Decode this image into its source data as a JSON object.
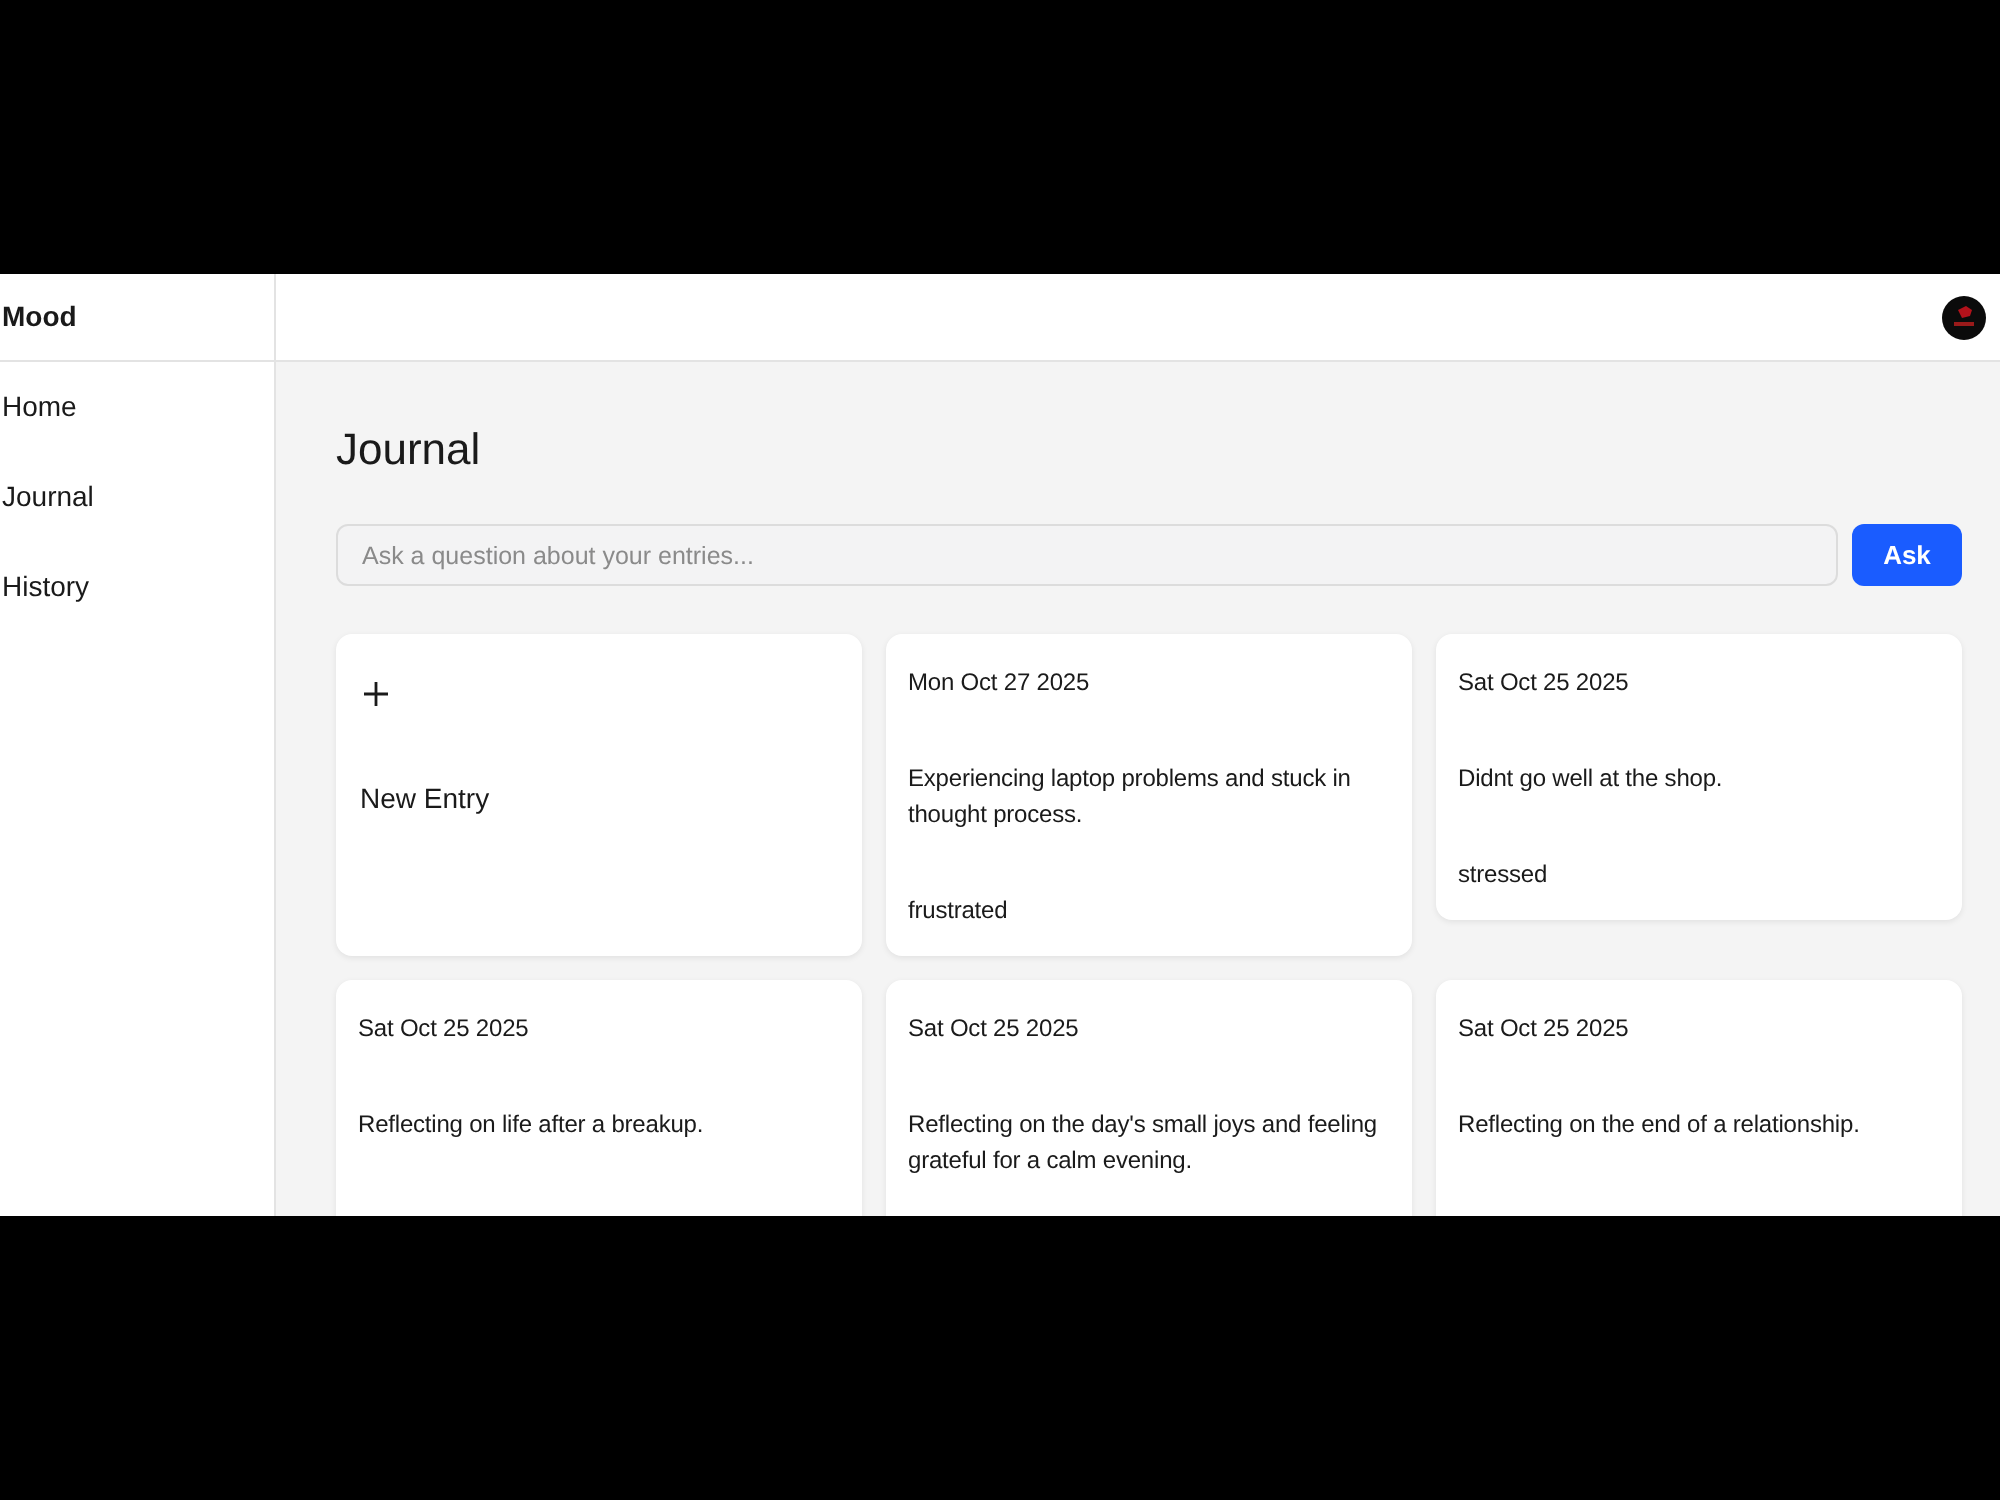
{
  "app": {
    "name": "Mood"
  },
  "sidebar": {
    "items": [
      {
        "label": "Home"
      },
      {
        "label": "Journal"
      },
      {
        "label": "History"
      }
    ]
  },
  "page": {
    "title": "Journal"
  },
  "search": {
    "placeholder": "Ask a question about your entries...",
    "button": "Ask"
  },
  "new_entry": {
    "label": "New Entry"
  },
  "entries": [
    {
      "date": "Mon Oct 27 2025",
      "text": "Experiencing laptop problems and stuck in thought process.",
      "mood": "frustrated"
    },
    {
      "date": "Sat Oct 25 2025",
      "text": "Didnt go well at the shop.",
      "mood": "stressed"
    },
    {
      "date": "Sat Oct 25 2025",
      "text": "Reflecting on life after a breakup."
    },
    {
      "date": "Sat Oct 25 2025",
      "text": "Reflecting on the day's small joys and feeling grateful for a calm evening."
    },
    {
      "date": "Sat Oct 25 2025",
      "text": "Reflecting on the end of a relationship."
    }
  ]
}
